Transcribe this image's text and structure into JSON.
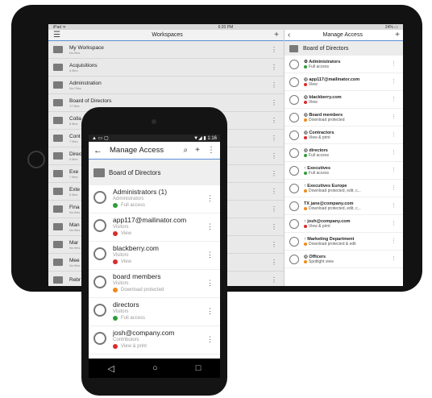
{
  "tablet": {
    "status": {
      "left": "iPad ᯤ",
      "time": "6:20 PM",
      "right": "24% ▭"
    },
    "left_panel": {
      "title": "Workspaces",
      "items": [
        {
          "name": "My Workspace",
          "sub": "No files"
        },
        {
          "name": "Acquisitions",
          "sub": "4 files"
        },
        {
          "name": "Adminstration",
          "sub": "No Files"
        },
        {
          "name": "Board of Directors",
          "sub": "17 files"
        },
        {
          "name": "Colla",
          "sub": "8 files"
        },
        {
          "name": "Cont",
          "sub": "7 files"
        },
        {
          "name": "Direc",
          "sub": "5 files"
        },
        {
          "name": "Exe",
          "sub": "7 files"
        },
        {
          "name": "Exte",
          "sub": "5 files"
        },
        {
          "name": "Fina",
          "sub": "No files"
        },
        {
          "name": "Man",
          "sub": "No files"
        },
        {
          "name": "Mar",
          "sub": "No files"
        },
        {
          "name": "Mee",
          "sub": "No files"
        },
        {
          "name": "Rebr",
          "sub": ""
        }
      ]
    },
    "right_panel": {
      "title": "Manage Access",
      "header": "Board of Directors",
      "items": [
        {
          "name": "⚙ Administrators",
          "perm": "Full access",
          "color": "#2e9d3c"
        },
        {
          "name": "◎ app117@mailinator.com",
          "perm": "View",
          "color": "#d92b2b"
        },
        {
          "name": "◎ blackberry.com",
          "perm": "View",
          "color": "#d92b2b"
        },
        {
          "name": "◎ Board members",
          "perm": "Download protected",
          "color": "#f08a1c"
        },
        {
          "name": "◎ Contractors",
          "perm": "View & print",
          "color": "#d92b2b"
        },
        {
          "name": "◎ directors",
          "perm": "Full access",
          "color": "#2e9d3c"
        },
        {
          "name": "↑ Executives",
          "perm": "Full access",
          "color": "#2e9d3c"
        },
        {
          "name": "↑ Executives Europe",
          "perm": "Download protected, edit, c...",
          "color": "#f08a1c"
        },
        {
          "name": "TX jane@company.com",
          "perm": "Download protected, edit, c...",
          "color": "#f08a1c"
        },
        {
          "name": "↑ josh@company.com",
          "perm": "View & print",
          "color": "#d92b2b"
        },
        {
          "name": "↑ Marketing Department",
          "perm": "Download protected & edit",
          "color": "#f08a1c"
        },
        {
          "name": "◎ Officers",
          "perm": "Spotlight view",
          "color": "#f08a1c"
        }
      ]
    }
  },
  "phone": {
    "status": {
      "left": "▲ ▭ ▢",
      "right": "▼◢ ▮ 1:16"
    },
    "title": "Manage Access",
    "header": "Board of Directors",
    "items": [
      {
        "name": "Administrators (1)",
        "role": "Administrators",
        "perm": "Full access",
        "color": "#2e9d3c"
      },
      {
        "name": "app117@mailinator.com",
        "role": "Visitors",
        "perm": "View",
        "color": "#d92b2b"
      },
      {
        "name": "blackberry.com",
        "role": "Visitors",
        "perm": "View",
        "color": "#d92b2b"
      },
      {
        "name": "board members",
        "role": "Visitors",
        "perm": "Download protected",
        "color": "#f08a1c"
      },
      {
        "name": "directors",
        "role": "Visitors",
        "perm": "Full access",
        "color": "#2e9d3c"
      },
      {
        "name": "josh@company.com",
        "role": "Contributors",
        "perm": "View & print",
        "color": "#d92b2b"
      }
    ],
    "nav": {
      "back": "◁",
      "home": "○",
      "recent": "□"
    }
  }
}
